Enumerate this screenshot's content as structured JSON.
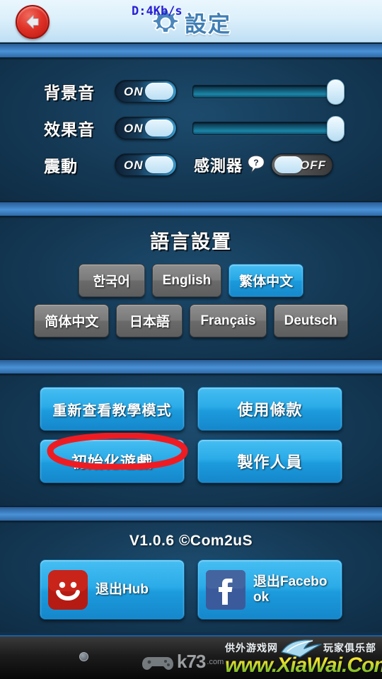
{
  "header": {
    "back_icon": "back-arrow-icon",
    "gear_icon": "gear-icon",
    "title": "設定",
    "network_speed": "D:4Kb/s"
  },
  "sound": {
    "rows": [
      {
        "label": "背景音",
        "toggle_state": "ON",
        "slider_value": 100
      },
      {
        "label": "效果音",
        "toggle_state": "ON",
        "slider_value": 100
      },
      {
        "label": "震動",
        "toggle_state": "ON"
      }
    ],
    "sensor": {
      "label": "感測器",
      "help_icon": "question-help-icon",
      "toggle_state": "OFF"
    }
  },
  "language": {
    "title": "語言設置",
    "row1": [
      {
        "label": "한국어",
        "selected": false
      },
      {
        "label": "English",
        "selected": false
      },
      {
        "label": "繁体中文",
        "selected": true
      }
    ],
    "row2": [
      {
        "label": "简体中文",
        "selected": false
      },
      {
        "label": "日本語",
        "selected": false
      },
      {
        "label": "Français",
        "selected": false
      },
      {
        "label": "Deutsch",
        "selected": false
      }
    ]
  },
  "actions": {
    "tutorial": "重新查看教學模式",
    "terms": "使用條款",
    "reset_game": "初始化遊戲",
    "credits": "製作人員",
    "annotation_color": "#ee1c22"
  },
  "account": {
    "version": "V1.0.6 ©Com2uS",
    "hub": {
      "label": "退出Hub",
      "icon": "hub-smiley-icon"
    },
    "facebook": {
      "label": "退出Facebook",
      "icon": "facebook-icon"
    }
  },
  "navbar": {
    "k73_text": "k73",
    "k73_sub": ".com",
    "watermark_left": "供外游戏网",
    "watermark_right": "玩家俱乐部",
    "url": "www.XiaWai.Com"
  }
}
